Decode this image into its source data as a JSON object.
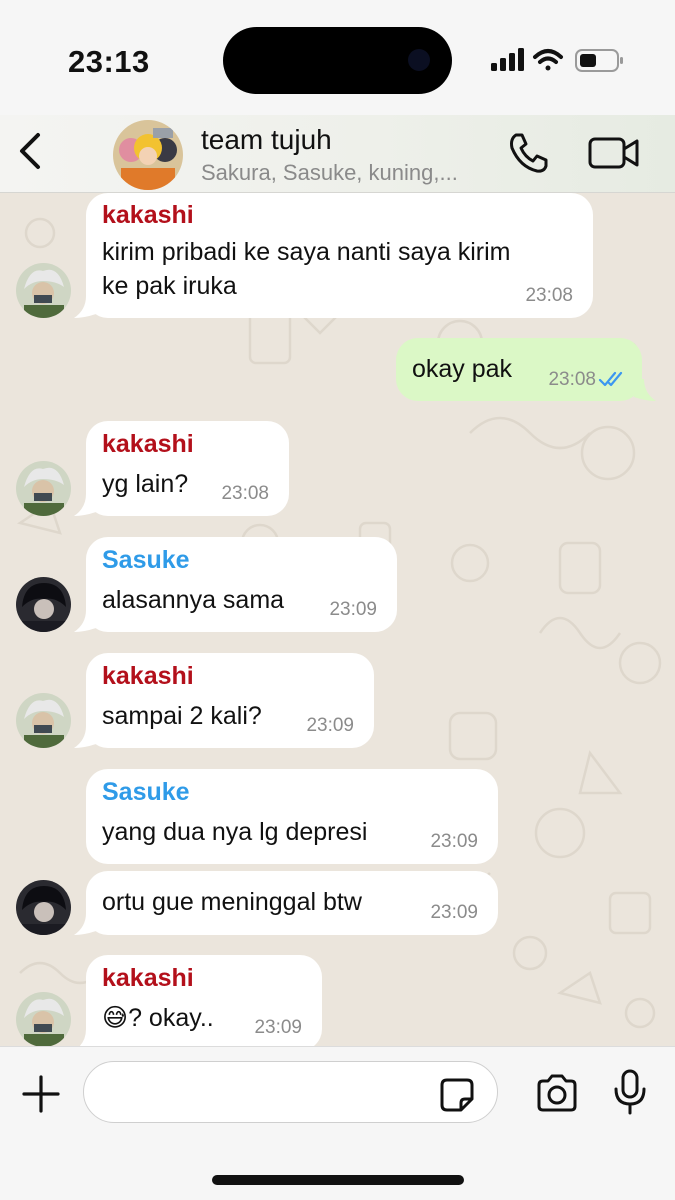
{
  "status_bar": {
    "time": "23:13"
  },
  "header": {
    "title": "team tujuh",
    "members": "Sakura, Sasuke, kuning,..."
  },
  "messages": [
    {
      "sender": "kakashi",
      "text_line1": "kirim pribadi ke saya nanti saya kirim",
      "text_line2": "ke pak iruka",
      "time": "23:08"
    },
    {
      "text": "okay pak",
      "time": "23:08"
    },
    {
      "sender": "kakashi",
      "text": "yg lain?",
      "time": "23:08"
    },
    {
      "sender": "Sasuke",
      "text": "alasannya sama",
      "time": "23:09"
    },
    {
      "sender": "kakashi",
      "text": "sampai 2 kali?",
      "time": "23:09"
    },
    {
      "sender": "Sasuke",
      "text": "yang dua nya lg depresi",
      "time": "23:09"
    },
    {
      "text": "ortu gue meninggal btw",
      "time": "23:09"
    },
    {
      "sender": "kakashi",
      "emoji": "😅",
      "text": "? okay..",
      "time": "23:09"
    }
  ],
  "input": {
    "placeholder": ""
  },
  "colors": {
    "kakashi_name": "#b3101b",
    "sasuke_name": "#2f9be8",
    "outgoing_bubble": "#dbf8c6",
    "read_ticks": "#3b97f0"
  },
  "icons": [
    "back-icon",
    "call-icon",
    "video-call-icon",
    "plus-icon",
    "sticker-icon",
    "camera-icon",
    "mic-icon",
    "read-receipt-icon"
  ]
}
